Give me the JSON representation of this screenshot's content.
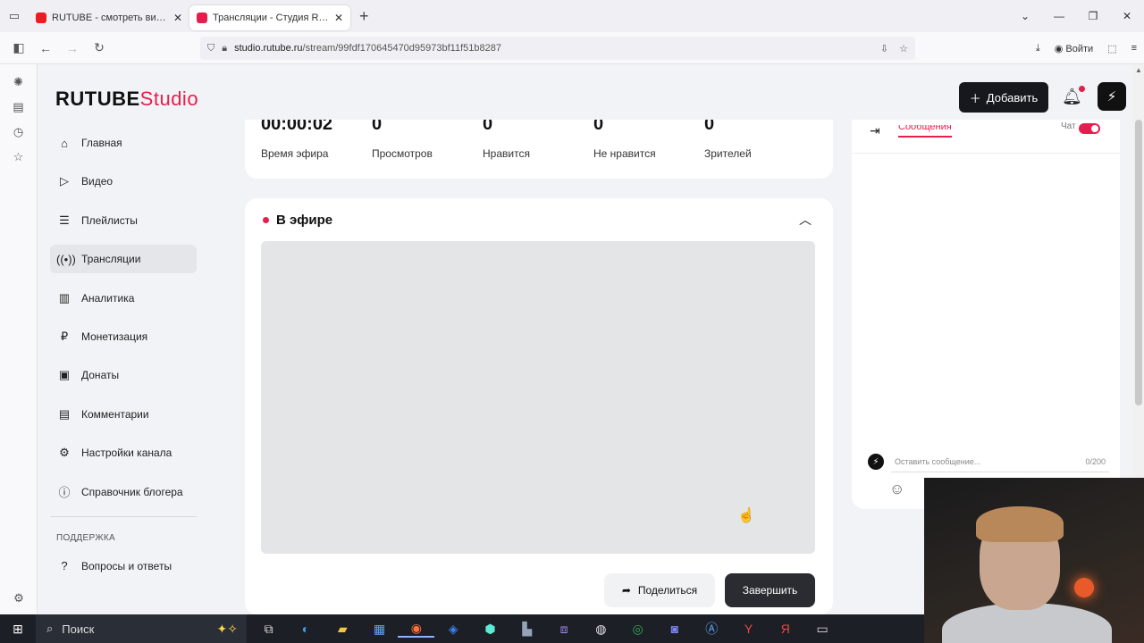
{
  "browser": {
    "tabs": [
      {
        "title": "RUTUBE - смотреть видео онлайн",
        "active": false
      },
      {
        "title": "Трансляции - Студия RUTUBE",
        "active": true
      }
    ],
    "url_host": "studio.rutube.ru",
    "url_path": "/stream/99fdf170645470d95973bf11f51b8287",
    "login_label": "Войти"
  },
  "app": {
    "logo_main": "RUTUBE",
    "logo_studio": "Studio",
    "add_label": "Добавить"
  },
  "menu": {
    "items": [
      {
        "label": "Главная",
        "icon": "home-icon"
      },
      {
        "label": "Видео",
        "icon": "video-icon"
      },
      {
        "label": "Плейлисты",
        "icon": "playlist-icon"
      },
      {
        "label": "Трансляции",
        "icon": "broadcast-icon",
        "active": true
      },
      {
        "label": "Аналитика",
        "icon": "analytics-icon"
      },
      {
        "label": "Монетизация",
        "icon": "ruble-icon"
      },
      {
        "label": "Донаты",
        "icon": "wallet-icon"
      },
      {
        "label": "Комментарии",
        "icon": "comment-icon"
      },
      {
        "label": "Настройки канала",
        "icon": "gear-icon"
      },
      {
        "label": "Справочник блогера",
        "icon": "info-icon"
      }
    ],
    "support_section": "ПОДДЕРЖКА",
    "support_items": [
      {
        "label": "Вопросы и ответы",
        "icon": "question-icon"
      }
    ]
  },
  "stats": [
    {
      "value": "00:00:02",
      "label": "Время эфира"
    },
    {
      "value": "0",
      "label": "Просмотров"
    },
    {
      "value": "0",
      "label": "Нравится"
    },
    {
      "value": "0",
      "label": "Не нравится"
    },
    {
      "value": "0",
      "label": "Зрителей"
    }
  ],
  "live": {
    "title": "В эфире",
    "share_label": "Поделиться",
    "end_label": "Завершить"
  },
  "chat": {
    "tab_messages": "Сообщения",
    "chat_toggle_label": "Чат",
    "input_placeholder": "Оставить сообщение...",
    "counter": "0/200"
  },
  "taskbar": {
    "search_label": "Поиск"
  },
  "colors": {
    "brand": "#e61e4d",
    "dark_button": "#16181d"
  }
}
